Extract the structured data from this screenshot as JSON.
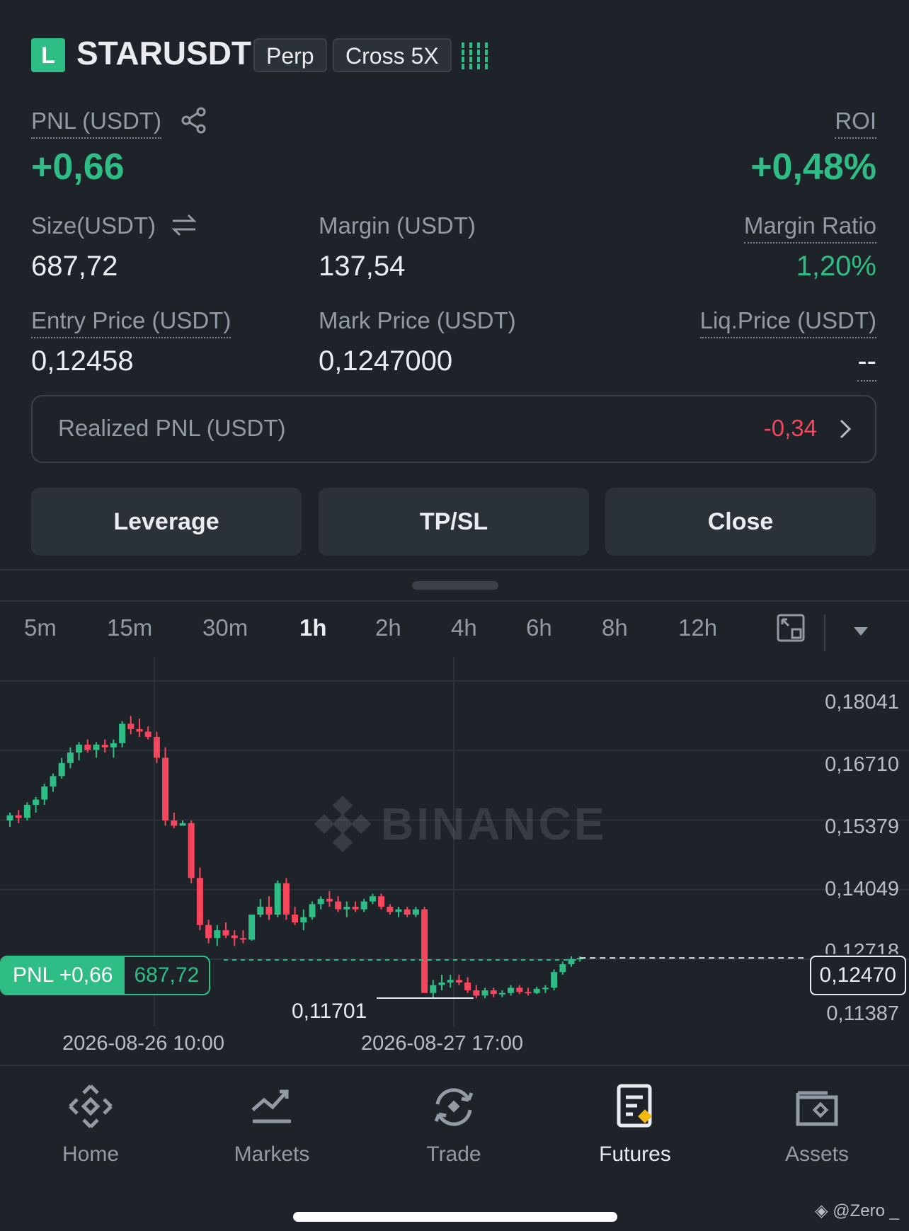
{
  "header": {
    "side_badge": "L",
    "symbol": "STARUSDT",
    "tag_perp": "Perp",
    "tag_margin": "Cross 5X"
  },
  "pnl": {
    "label": "PNL (USDT)",
    "value": "+0,66",
    "roi_label": "ROI",
    "roi_value": "+0,48%"
  },
  "stats": {
    "size_label": "Size(USDT)",
    "size_value": "687,72",
    "margin_label": "Margin (USDT)",
    "margin_value": "137,54",
    "margin_ratio_label": "Margin Ratio",
    "margin_ratio_value": "1,20%",
    "entry_label": "Entry Price (USDT)",
    "entry_value": "0,12458",
    "mark_label": "Mark Price (USDT)",
    "mark_value": "0,1247000",
    "liq_label": "Liq.Price (USDT)",
    "liq_value": "--"
  },
  "realized": {
    "label": "Realized PNL (USDT)",
    "value": "-0,34"
  },
  "actions": {
    "leverage": "Leverage",
    "tpsl": "TP/SL",
    "close": "Close"
  },
  "timeframes": [
    "5m",
    "15m",
    "30m",
    "1h",
    "2h",
    "4h",
    "6h",
    "8h",
    "12h"
  ],
  "active_timeframe": "1h",
  "chart": {
    "y_ticks": [
      "0,18041",
      "0,16710",
      "0,15379",
      "0,14049",
      "0,12718",
      "0,11387"
    ],
    "x_ticks": [
      "2026-08-26 10:00",
      "2026-08-27 17:00"
    ],
    "low_marker": "0,11701",
    "pnl_tag": "PNL +0,66",
    "size_tag": "687,72",
    "price_tag": "0,12470",
    "watermark": "BINANCE"
  },
  "chart_data": {
    "type": "candlestick",
    "interval": "1h",
    "ylim": [
      0.1116,
      0.1823
    ],
    "up_color": "#2ebd85",
    "down_color": "#f6465d",
    "last_price": 0.1247,
    "entry_price": 0.12458,
    "min_marked": 0.11701,
    "ohlc": [
      [
        0.151,
        0.1525,
        0.1498,
        0.152
      ],
      [
        0.152,
        0.153,
        0.1505,
        0.1515
      ],
      [
        0.1515,
        0.1545,
        0.151,
        0.154
      ],
      [
        0.154,
        0.1555,
        0.1525,
        0.155
      ],
      [
        0.155,
        0.158,
        0.154,
        0.1575
      ],
      [
        0.1575,
        0.16,
        0.1565,
        0.1595
      ],
      [
        0.1595,
        0.163,
        0.159,
        0.162
      ],
      [
        0.162,
        0.165,
        0.161,
        0.164
      ],
      [
        0.164,
        0.166,
        0.1625,
        0.1655
      ],
      [
        0.1655,
        0.1665,
        0.164,
        0.1645
      ],
      [
        0.1645,
        0.166,
        0.163,
        0.1655
      ],
      [
        0.1655,
        0.1665,
        0.164,
        0.165
      ],
      [
        0.165,
        0.1665,
        0.163,
        0.1658
      ],
      [
        0.1658,
        0.17,
        0.165,
        0.1695
      ],
      [
        0.1695,
        0.171,
        0.1675,
        0.1685
      ],
      [
        0.1685,
        0.1705,
        0.167,
        0.168
      ],
      [
        0.168,
        0.169,
        0.1665,
        0.167
      ],
      [
        0.167,
        0.168,
        0.162,
        0.163
      ],
      [
        0.163,
        0.165,
        0.15,
        0.151
      ],
      [
        0.151,
        0.1525,
        0.1495,
        0.15
      ],
      [
        0.15,
        0.151,
        0.15,
        0.1505
      ],
      [
        0.1505,
        0.151,
        0.139,
        0.14
      ],
      [
        0.14,
        0.142,
        0.13,
        0.131
      ],
      [
        0.131,
        0.132,
        0.1275,
        0.1285
      ],
      [
        0.1285,
        0.131,
        0.127,
        0.13
      ],
      [
        0.13,
        0.1315,
        0.1285,
        0.129
      ],
      [
        0.129,
        0.13,
        0.127,
        0.1285
      ],
      [
        0.1285,
        0.13,
        0.1275,
        0.1282
      ],
      [
        0.1282,
        0.133,
        0.128,
        0.133
      ],
      [
        0.133,
        0.136,
        0.1325,
        0.1345
      ],
      [
        0.1345,
        0.1365,
        0.132,
        0.133
      ],
      [
        0.133,
        0.1395,
        0.1325,
        0.139
      ],
      [
        0.139,
        0.14,
        0.132,
        0.133
      ],
      [
        0.133,
        0.1345,
        0.131,
        0.1315
      ],
      [
        0.1315,
        0.134,
        0.13,
        0.1325
      ],
      [
        0.1325,
        0.1355,
        0.132,
        0.135
      ],
      [
        0.135,
        0.1365,
        0.134,
        0.136
      ],
      [
        0.136,
        0.1375,
        0.1345,
        0.1355
      ],
      [
        0.1355,
        0.1365,
        0.1335,
        0.134
      ],
      [
        0.134,
        0.1355,
        0.1325,
        0.1345
      ],
      [
        0.1345,
        0.1355,
        0.1335,
        0.134
      ],
      [
        0.134,
        0.136,
        0.1335,
        0.1355
      ],
      [
        0.1355,
        0.137,
        0.135,
        0.1365
      ],
      [
        0.1365,
        0.137,
        0.134,
        0.1345
      ],
      [
        0.1345,
        0.135,
        0.133,
        0.1335
      ],
      [
        0.1335,
        0.1345,
        0.1325,
        0.134
      ],
      [
        0.134,
        0.1345,
        0.1325,
        0.133
      ],
      [
        0.133,
        0.1345,
        0.1325,
        0.134
      ],
      [
        0.134,
        0.1345,
        0.12,
        0.118
      ],
      [
        0.118,
        0.1205,
        0.117,
        0.1195
      ],
      [
        0.1195,
        0.1215,
        0.1185,
        0.12
      ],
      [
        0.12,
        0.1215,
        0.119,
        0.1205
      ],
      [
        0.1205,
        0.1215,
        0.1195,
        0.12
      ],
      [
        0.12,
        0.121,
        0.118,
        0.1185
      ],
      [
        0.1185,
        0.1195,
        0.117,
        0.1175
      ],
      [
        0.1175,
        0.119,
        0.117,
        0.1185
      ],
      [
        0.1185,
        0.119,
        0.1172,
        0.1178
      ],
      [
        0.1178,
        0.1185,
        0.1172,
        0.118
      ],
      [
        0.118,
        0.1195,
        0.1175,
        0.119
      ],
      [
        0.119,
        0.1195,
        0.1178,
        0.1182
      ],
      [
        0.1182,
        0.119,
        0.1175,
        0.118
      ],
      [
        0.118,
        0.1192,
        0.1178,
        0.1188
      ],
      [
        0.1188,
        0.1195,
        0.118,
        0.119
      ],
      [
        0.119,
        0.1225,
        0.1185,
        0.122
      ],
      [
        0.122,
        0.124,
        0.1215,
        0.1235
      ],
      [
        0.1235,
        0.125,
        0.123,
        0.1245
      ],
      [
        0.1245,
        0.125,
        0.124,
        0.1247
      ]
    ]
  },
  "nav": [
    {
      "label": "Home",
      "icon": "binance-logo-icon"
    },
    {
      "label": "Markets",
      "icon": "chart-trend-icon"
    },
    {
      "label": "Trade",
      "icon": "swap-cycle-icon"
    },
    {
      "label": "Futures",
      "icon": "futures-document-icon"
    },
    {
      "label": "Assets",
      "icon": "wallet-icon"
    }
  ],
  "active_nav": "Futures",
  "watermark_user": "@Zero _"
}
